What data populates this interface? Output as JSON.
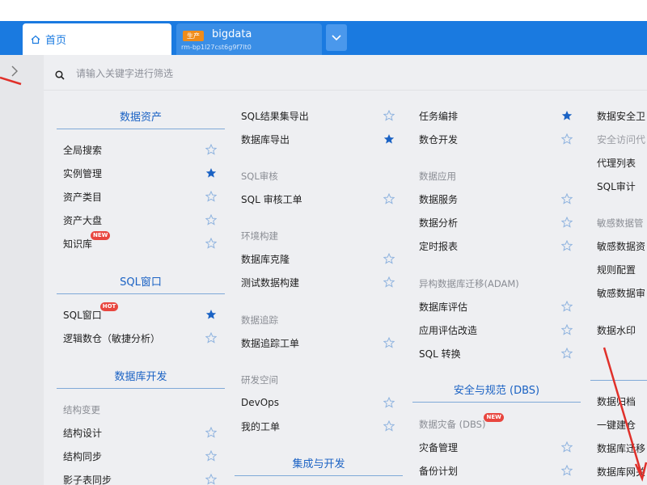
{
  "tabs": {
    "home": "首页",
    "db_env": "生产",
    "db_name": "bigdata",
    "db_id": "rm-bp1l27cst6g9f7lt0"
  },
  "search": {
    "placeholder": "请输入关键字进行筛选"
  },
  "colors": {
    "brand": "#1a7ae0",
    "star_filled": "#1a62c4",
    "star_empty": "#8fb3df",
    "badge": "#e8463f",
    "env_badge": "#f08c1a"
  },
  "col1": {
    "h1": "数据资产",
    "i1": "全局搜索",
    "i2": "实例管理",
    "i3": "资产类目",
    "i4": "资产大盘",
    "i5": "知识库",
    "i5_badge": "NEW",
    "h2": "SQL窗口",
    "i6": "SQL窗口",
    "i6_badge": "HOT",
    "i7": "逻辑数仓（敏捷分析）",
    "h3": "数据库开发",
    "g1": "结构变更",
    "i8": "结构设计",
    "i9": "结构同步",
    "i10": "影子表同步"
  },
  "col2": {
    "i1": "SQL结果集导出",
    "i2": "数据库导出",
    "g1": "SQL审核",
    "i3": "SQL 审核工单",
    "g2": "环境构建",
    "i4": "数据库克隆",
    "i5": "测试数据构建",
    "g3": "数据追踪",
    "i6": "数据追踪工单",
    "g4": "研发空间",
    "i7": "DevOps",
    "i8": "我的工单",
    "h1": "集成与开发"
  },
  "col3": {
    "i1": "任务编排",
    "i2": "数仓开发",
    "g1": "数据应用",
    "i3": "数据服务",
    "i4": "数据分析",
    "i5": "定时报表",
    "g2": "异构数据库迁移(ADAM)",
    "i6": "数据库评估",
    "i7": "应用评估改造",
    "i8": "SQL 转换",
    "h1": "安全与规范 (DBS)",
    "g3": "数据灾备 (DBS)",
    "g3_badge": "NEW",
    "i9": "灾备管理",
    "i10": "备份计划"
  },
  "col4": {
    "i1": "数据安全卫",
    "g1": "安全访问代",
    "i2": "代理列表",
    "i3": "SQL审计",
    "g2": "敏感数据管",
    "i4": "敏感数据资",
    "i5": "规则配置",
    "i6": "敏感数据审",
    "i7": "数据水印",
    "i8": "数据归档",
    "i9": "一键建仓",
    "i10": "数据库迁移",
    "i11": "数据库网关"
  }
}
